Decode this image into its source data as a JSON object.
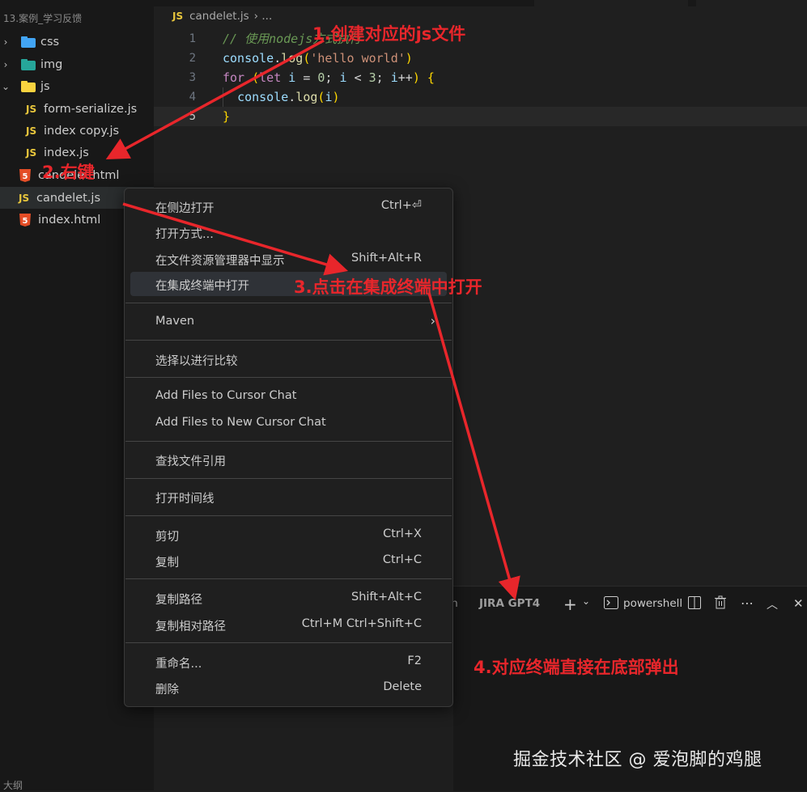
{
  "explorer": {
    "folder_title": "13.案例_学习反馈",
    "items": [
      {
        "label": "css",
        "type": "folder"
      },
      {
        "label": "img",
        "type": "folder"
      },
      {
        "label": "js",
        "type": "folder-open"
      },
      {
        "label": "form-serialize.js",
        "type": "js"
      },
      {
        "label": "index copy.js",
        "type": "js"
      },
      {
        "label": "index.js",
        "type": "js"
      },
      {
        "label": "candelet.html",
        "type": "html"
      },
      {
        "label": "candelet.js",
        "type": "js"
      },
      {
        "label": "index.html",
        "type": "html"
      }
    ],
    "outline_label": "大纲",
    "js_icon_text": "JS"
  },
  "editor": {
    "breadcrumb_file": "candelet.js",
    "breadcrumb_rest": "› ...",
    "lines": [
      {
        "num": "1",
        "text": "// 使用nodejs方式执行"
      },
      {
        "num": "2",
        "text": "console.log('hello world')"
      },
      {
        "num": "3",
        "text": "for (let i = 0; i < 3; i++) {"
      },
      {
        "num": "4",
        "text": "  console.log(i)"
      },
      {
        "num": "5",
        "text": "}"
      }
    ]
  },
  "context_menu": {
    "items": [
      {
        "label": "在侧边打开",
        "shortcut": "Ctrl+⏎"
      },
      {
        "label": "打开方式...",
        "shortcut": ""
      },
      {
        "label": "在文件资源管理器中显示",
        "shortcut": "Shift+Alt+R"
      },
      {
        "label": "在集成终端中打开",
        "shortcut": ""
      },
      {
        "label": "Maven",
        "shortcut": "›"
      },
      {
        "label": "选择以进行比较",
        "shortcut": ""
      },
      {
        "label": "Add Files to Cursor Chat",
        "shortcut": ""
      },
      {
        "label": "Add Files to New Cursor Chat",
        "shortcut": ""
      },
      {
        "label": "查找文件引用",
        "shortcut": ""
      },
      {
        "label": "打开时间线",
        "shortcut": ""
      },
      {
        "label": "剪切",
        "shortcut": "Ctrl+X"
      },
      {
        "label": "复制",
        "shortcut": "Ctrl+C"
      },
      {
        "label": "复制路径",
        "shortcut": "Shift+Alt+C"
      },
      {
        "label": "复制相对路径",
        "shortcut": "Ctrl+M Ctrl+Shift+C"
      },
      {
        "label": "重命名...",
        "shortcut": "F2"
      },
      {
        "label": "删除",
        "shortcut": "Delete"
      }
    ]
  },
  "terminal": {
    "tab_partial": "th",
    "tab_jira": "JIRA GPT4",
    "shell_name": "powershell"
  },
  "annotations": {
    "step1": "1.创建对应的js文件",
    "step2": "2.右键",
    "step3": "3.点击在集成终端中打开",
    "step4": "4.对应终端直接在底部弹出"
  },
  "watermark": "掘金技术社区 @ 爱泡脚的鸡腿",
  "colors": {
    "annotation": "#e8262b",
    "js_icon": "#e8c63c",
    "html_icon": "#e44d26",
    "keyword": "#c586c0",
    "string": "#ce9178",
    "number": "#b5cea8",
    "comment": "#6a9955"
  }
}
